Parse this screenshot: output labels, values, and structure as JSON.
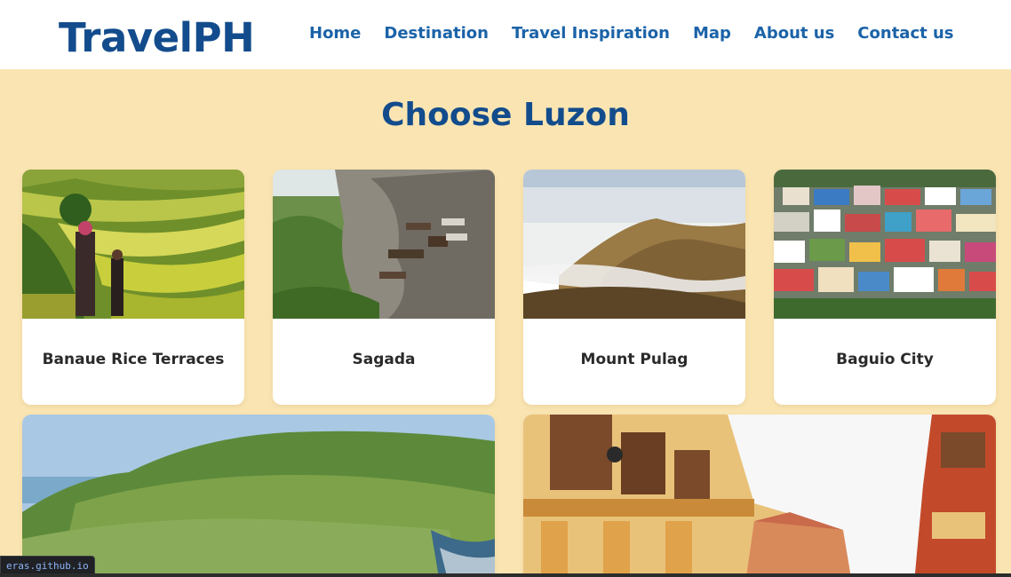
{
  "header": {
    "brand": "TravelPH",
    "nav": [
      "Home",
      "Destination",
      "Travel Inspiration",
      "Map",
      "About us",
      "Contact us"
    ]
  },
  "main": {
    "title": "Choose Luzon",
    "cards": [
      {
        "label": "Banaue Rice Terraces"
      },
      {
        "label": "Sagada"
      },
      {
        "label": "Mount Pulag"
      },
      {
        "label": "Baguio City"
      },
      {
        "label": ""
      },
      {
        "label": ""
      }
    ]
  },
  "status": {
    "url": "eras.github.io"
  },
  "colors": {
    "brand": "#134c8c",
    "nav": "#1b63a8",
    "background": "#fae5b2"
  }
}
